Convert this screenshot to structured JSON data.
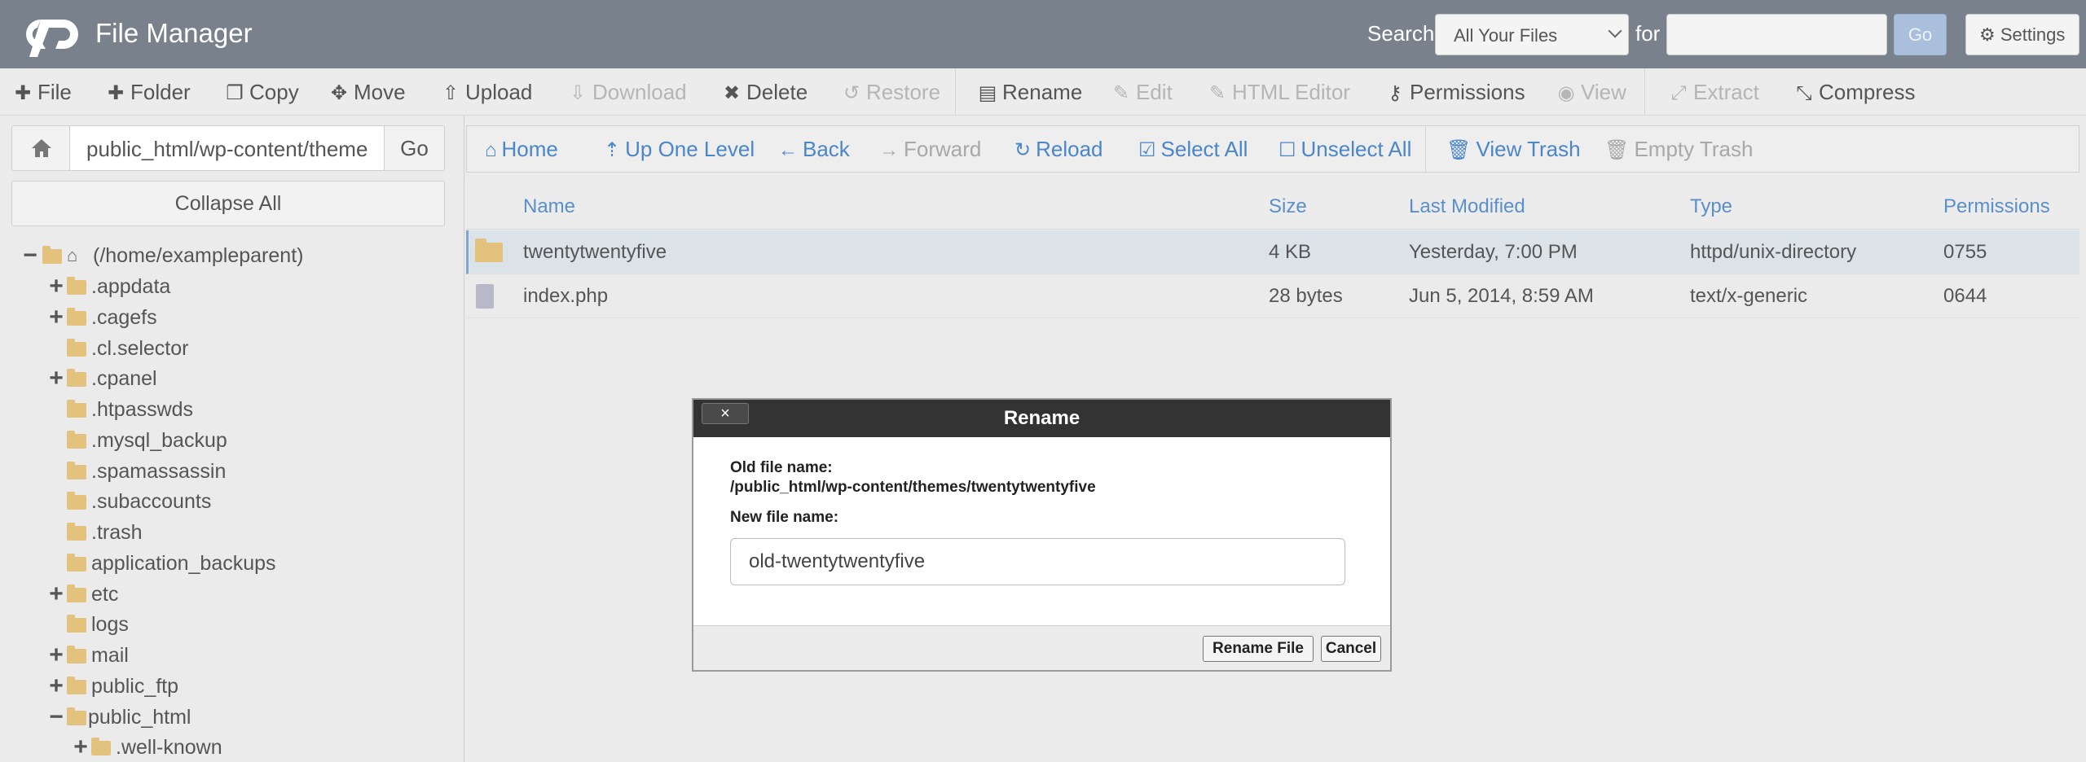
{
  "header": {
    "title": "File Manager",
    "search_label": "Search",
    "search_scope": "All Your Files",
    "for_label": "for",
    "search_query": "",
    "go_label": "Go",
    "settings_label": "Settings"
  },
  "toolbar": {
    "items": [
      {
        "label": "File",
        "icon": "plus-icon",
        "enabled": true
      },
      {
        "label": "Folder",
        "icon": "plus-icon",
        "enabled": true
      },
      {
        "label": "Copy",
        "icon": "copy-icon",
        "enabled": true
      },
      {
        "label": "Move",
        "icon": "move-icon",
        "enabled": true
      },
      {
        "label": "Upload",
        "icon": "upload-icon",
        "enabled": true
      },
      {
        "label": "Download",
        "icon": "download-icon",
        "enabled": false
      },
      {
        "label": "Delete",
        "icon": "x-icon",
        "enabled": true
      },
      {
        "label": "Restore",
        "icon": "undo-icon",
        "enabled": false
      },
      {
        "label": "Rename",
        "icon": "file-icon",
        "enabled": true
      },
      {
        "label": "Edit",
        "icon": "pencil-icon",
        "enabled": false
      },
      {
        "label": "HTML Editor",
        "icon": "edit-box-icon",
        "enabled": false
      },
      {
        "label": "Permissions",
        "icon": "key-icon",
        "enabled": true
      },
      {
        "label": "View",
        "icon": "eye-icon",
        "enabled": false
      },
      {
        "label": "Extract",
        "icon": "expand-icon",
        "enabled": false
      },
      {
        "label": "Compress",
        "icon": "compress-icon",
        "enabled": true
      }
    ]
  },
  "sidebar": {
    "path": "public_html/wp-content/theme",
    "go_label": "Go",
    "collapse_label": "Collapse All",
    "tree": [
      {
        "label": "(/home/exampleparent)",
        "toggle": "−"
      },
      {
        "label": ".appdata",
        "toggle": "+"
      },
      {
        "label": ".cagefs",
        "toggle": "+"
      },
      {
        "label": ".cl.selector",
        "toggle": ""
      },
      {
        "label": ".cpanel",
        "toggle": "+"
      },
      {
        "label": ".htpasswds",
        "toggle": ""
      },
      {
        "label": ".mysql_backup",
        "toggle": ""
      },
      {
        "label": ".spamassassin",
        "toggle": ""
      },
      {
        "label": ".subaccounts",
        "toggle": ""
      },
      {
        "label": ".trash",
        "toggle": ""
      },
      {
        "label": "application_backups",
        "toggle": ""
      },
      {
        "label": "etc",
        "toggle": "+"
      },
      {
        "label": "logs",
        "toggle": ""
      },
      {
        "label": "mail",
        "toggle": "+"
      },
      {
        "label": "public_ftp",
        "toggle": "+"
      },
      {
        "label": "public_html",
        "toggle": "−"
      },
      {
        "label": ".well-known",
        "toggle": "+"
      }
    ]
  },
  "navbar": {
    "items": [
      {
        "label": "Home",
        "icon": "home-icon",
        "enabled": true
      },
      {
        "label": "Up One Level",
        "icon": "level-up-icon",
        "enabled": true
      },
      {
        "label": "Back",
        "icon": "arrow-left-icon",
        "enabled": true
      },
      {
        "label": "Forward",
        "icon": "arrow-right-icon",
        "enabled": false
      },
      {
        "label": "Reload",
        "icon": "reload-icon",
        "enabled": true
      },
      {
        "label": "Select All",
        "icon": "checkbox-checked-icon",
        "enabled": true
      },
      {
        "label": "Unselect All",
        "icon": "checkbox-empty-icon",
        "enabled": true
      },
      {
        "label": "View Trash",
        "icon": "trash-icon",
        "enabled": true
      },
      {
        "label": "Empty Trash",
        "icon": "trash-icon",
        "enabled": false
      }
    ]
  },
  "table": {
    "columns": [
      "Name",
      "Size",
      "Last Modified",
      "Type",
      "Permissions"
    ],
    "rows": [
      {
        "name": "twentytwentyfive",
        "size": "4 KB",
        "modified": "Yesterday, 7:00 PM",
        "type": "httpd/unix-directory",
        "perms": "0755",
        "kind": "folder",
        "selected": true
      },
      {
        "name": "index.php",
        "size": "28 bytes",
        "modified": "Jun 5, 2014, 8:59 AM",
        "type": "text/x-generic",
        "perms": "0644",
        "kind": "file",
        "selected": false
      }
    ]
  },
  "modal": {
    "title": "Rename",
    "close_label": "×",
    "old_label": "Old file name:",
    "old_value": "/public_html/wp-content/themes/twentytwentyfive",
    "new_label": "New file name:",
    "new_value": "old-twentytwentyfive",
    "rename_label": "Rename File",
    "cancel_label": "Cancel"
  }
}
